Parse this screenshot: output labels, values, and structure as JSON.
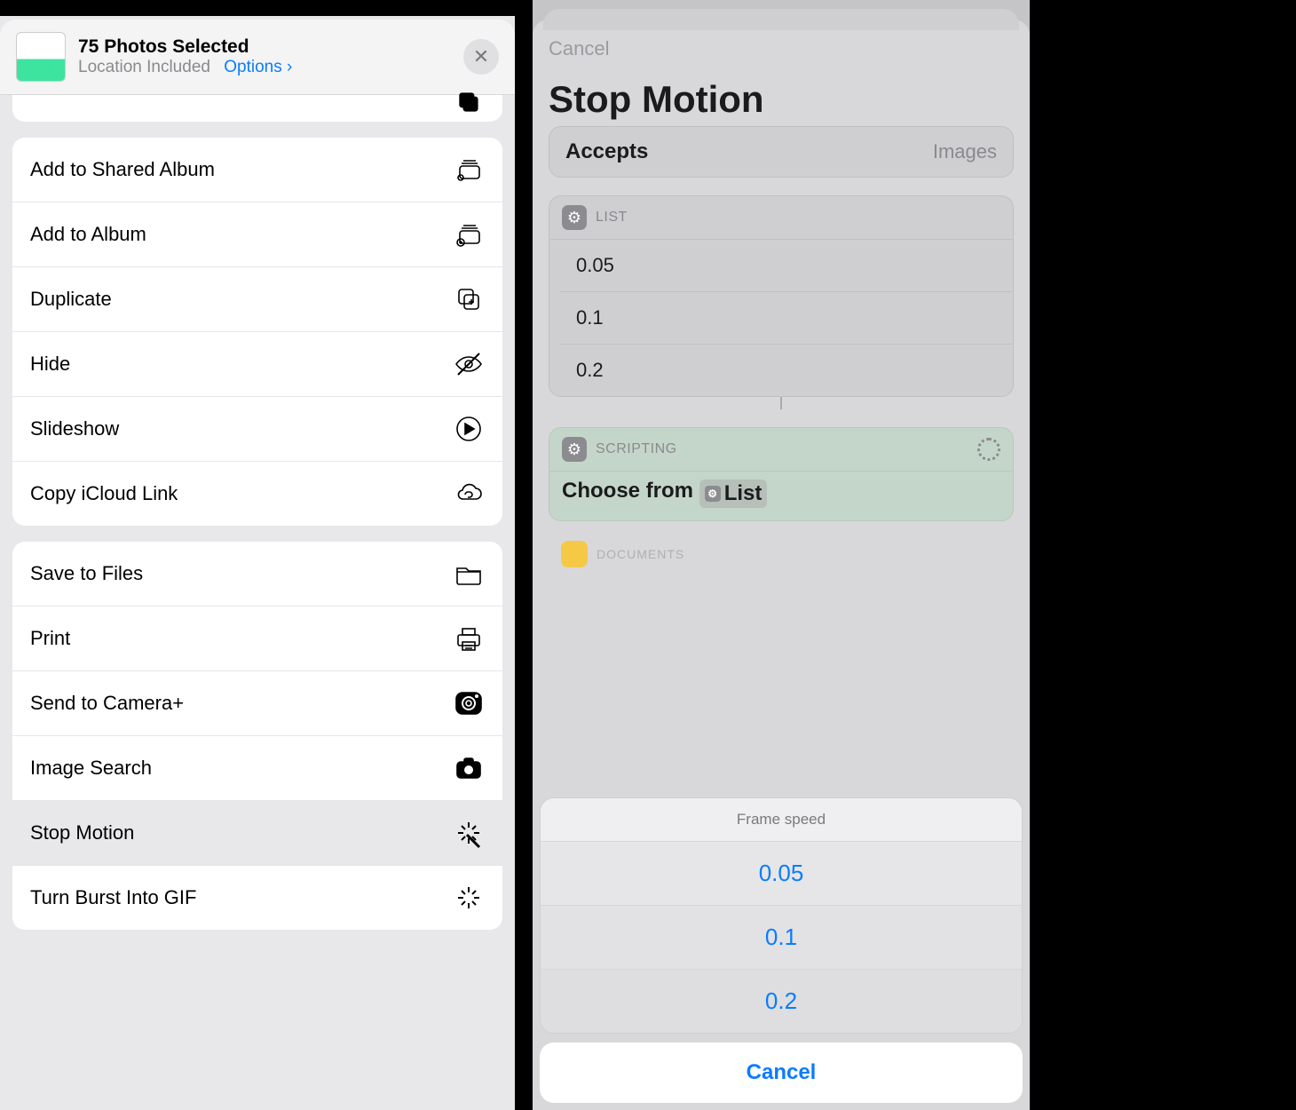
{
  "left": {
    "header": {
      "title": "75 Photos Selected",
      "subtitle": "Location Included",
      "options_label": "Options"
    },
    "group1_peek_icon": "copy-icon",
    "group1": [
      {
        "label": "Add to Shared Album",
        "icon": "shared-album-icon"
      },
      {
        "label": "Add to Album",
        "icon": "add-album-icon"
      },
      {
        "label": "Duplicate",
        "icon": "duplicate-icon"
      },
      {
        "label": "Hide",
        "icon": "hide-icon"
      },
      {
        "label": "Slideshow",
        "icon": "play-icon"
      },
      {
        "label": "Copy iCloud Link",
        "icon": "icloud-link-icon"
      }
    ],
    "group2": [
      {
        "label": "Save to Files",
        "icon": "folder-icon"
      },
      {
        "label": "Print",
        "icon": "printer-icon"
      },
      {
        "label": "Send to Camera+",
        "icon": "camera-plus-icon"
      },
      {
        "label": "Image Search",
        "icon": "camera-icon"
      },
      {
        "label": "Stop Motion",
        "icon": "sparkle-wand-icon",
        "highlight": true
      },
      {
        "label": "Turn Burst Into GIF",
        "icon": "sparkle-icon"
      }
    ]
  },
  "right": {
    "cancel": "Cancel",
    "title": "Stop Motion",
    "accepts_label": "Accepts",
    "accepts_value": "Images",
    "list_block": {
      "header": "LIST",
      "items": [
        "0.05",
        "0.1",
        "0.2"
      ]
    },
    "scripting_block": {
      "header": "SCRIPTING",
      "choose_prefix": "Choose from",
      "choose_token": "List"
    },
    "documents_peek": "DOCUMENTS",
    "sheet": {
      "title": "Frame speed",
      "options": [
        "0.05",
        "0.1",
        "0.2"
      ],
      "cancel": "Cancel"
    }
  }
}
